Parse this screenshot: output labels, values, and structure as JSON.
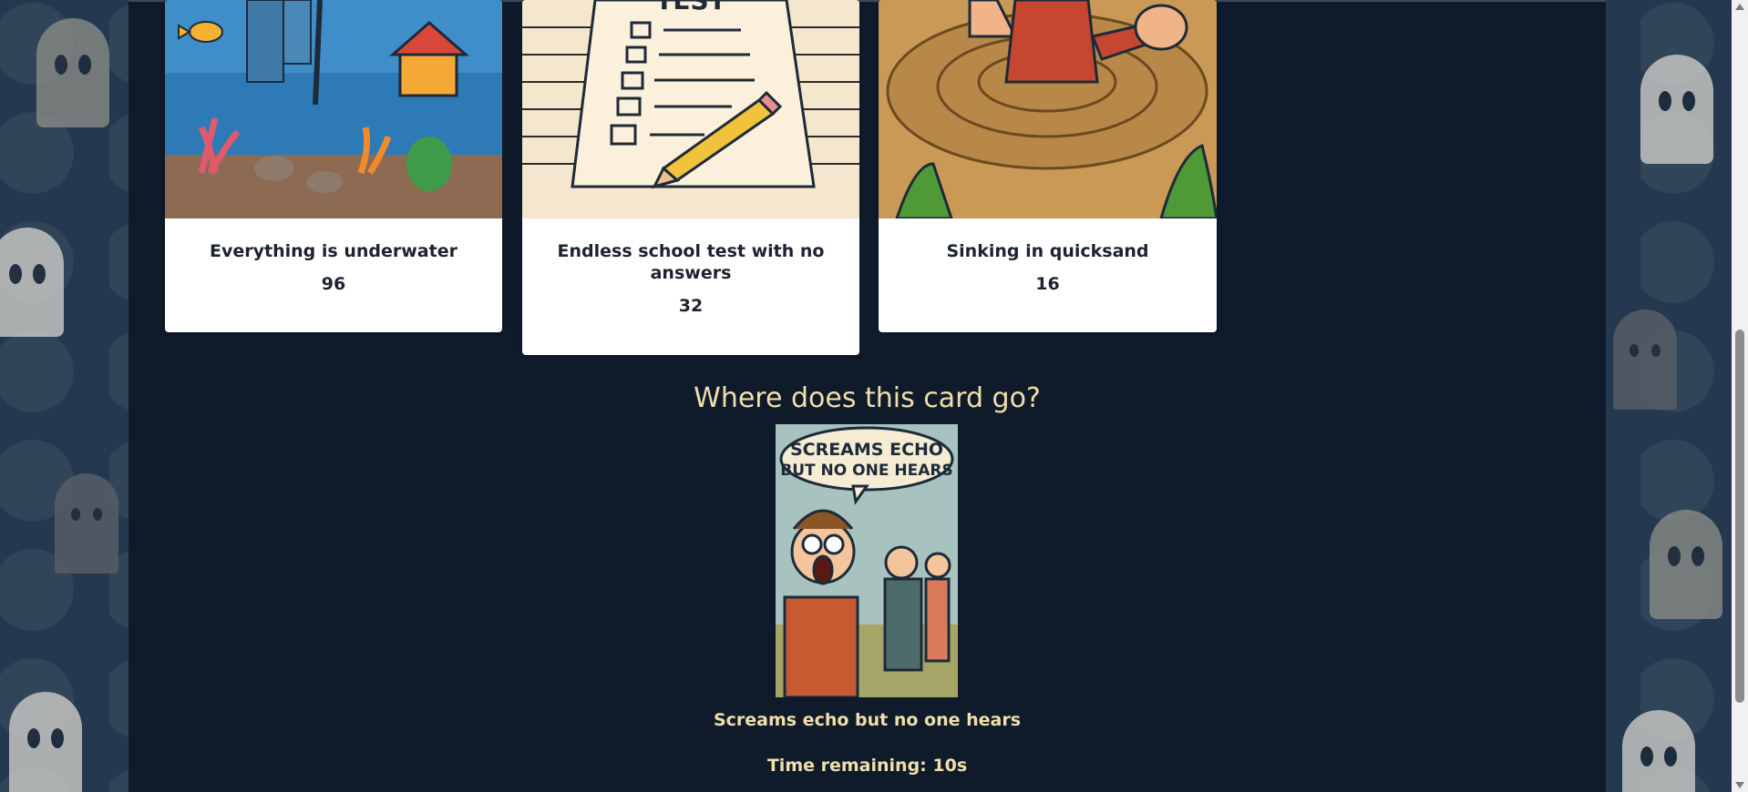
{
  "cards": [
    {
      "title": "Everything is underwater",
      "count": "96"
    },
    {
      "title": "Endless school test with no answers",
      "count": "32"
    },
    {
      "title": "Sinking in quicksand",
      "count": "16"
    }
  ],
  "test_sheet_word": "TEST",
  "prompt": {
    "question": "Where does this card go?",
    "card_image_text": "SCREAMS ECHO BUT NO ONE HEARS",
    "card_caption": "Screams echo but no one hears",
    "timer_text": "Time remaining: 10s"
  },
  "colors": {
    "panel": "#0f1b2b",
    "accent_text": "#f1dfaa",
    "card_bg": "#ffffff"
  }
}
